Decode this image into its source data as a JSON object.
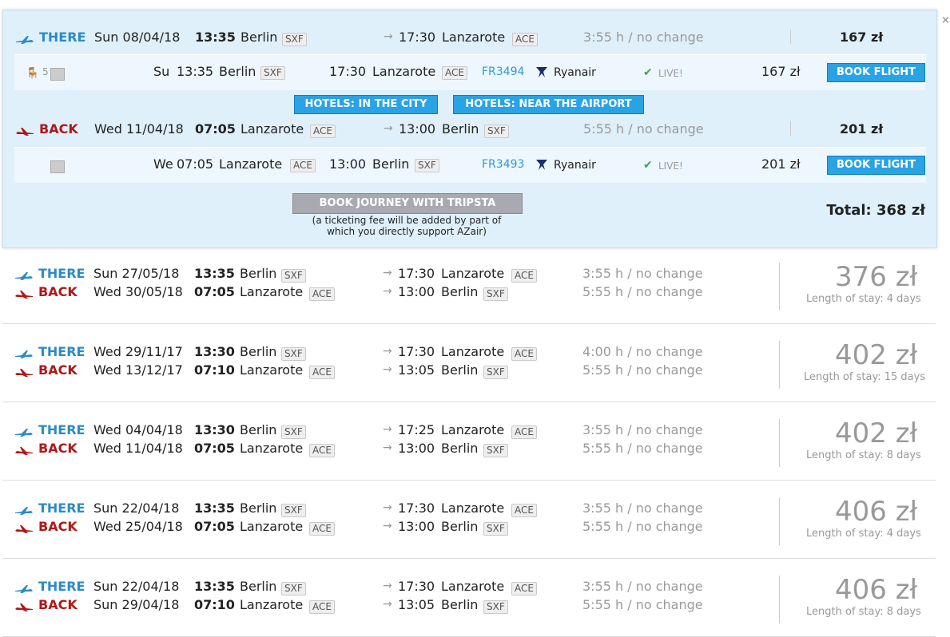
{
  "close_label": "×",
  "expanded": {
    "there": {
      "label": "THERE",
      "date": "Sun 08/04/18",
      "dep_time": "13:35",
      "dep_city": "Berlin",
      "dep_code": "SXF",
      "arr_time": "17:30",
      "arr_city": "Lanzarote",
      "arr_code": "ACE",
      "duration": "3:55 h / no change",
      "price": "167 zł"
    },
    "there_detail": {
      "seats": "5",
      "day": "Su",
      "dep_time": "13:35",
      "dep_city": "Berlin",
      "dep_code": "SXF",
      "arr_time": "17:30",
      "arr_city": "Lanzarote",
      "arr_code": "ACE",
      "flight_no": "FR3494",
      "airline": "Ryanair",
      "live": "LIVE!",
      "price": "167 zł",
      "book_label": "BOOK FLIGHT"
    },
    "hotels_city": "HOTELS: IN THE CITY",
    "hotels_airport": "HOTELS: NEAR THE AIRPORT",
    "back": {
      "label": "BACK",
      "date": "Wed 11/04/18",
      "dep_time": "07:05",
      "dep_city": "Lanzarote",
      "dep_code": "ACE",
      "arr_time": "13:00",
      "arr_city": "Berlin",
      "arr_code": "SXF",
      "duration": "5:55 h / no change",
      "price": "201 zł"
    },
    "back_detail": {
      "day": "We",
      "dep_time": "07:05",
      "dep_city": "Lanzarote",
      "dep_code": "ACE",
      "arr_time": "13:00",
      "arr_city": "Berlin",
      "arr_code": "SXF",
      "flight_no": "FR3493",
      "airline": "Ryanair",
      "live": "LIVE!",
      "price": "201 zł",
      "book_label": "BOOK FLIGHT"
    },
    "tripsta_label": "BOOK JOURNEY WITH TRIPSTA",
    "fee_line1": "(a ticketing fee will be added by part of",
    "fee_line2": "which you directly support AZair)",
    "total_label": "Total:",
    "total_value": "368 zł"
  },
  "results": [
    {
      "there": {
        "label": "THERE",
        "date": "Sun 27/05/18",
        "dep_time": "13:35",
        "dep_city": "Berlin",
        "dep_code": "SXF",
        "arr_time": "17:30",
        "arr_city": "Lanzarote",
        "arr_code": "ACE",
        "duration": "3:55 h / no change"
      },
      "back": {
        "label": "BACK",
        "date": "Wed 30/05/18",
        "dep_time": "07:05",
        "dep_city": "Lanzarote",
        "dep_code": "ACE",
        "arr_time": "13:00",
        "arr_city": "Berlin",
        "arr_code": "SXF",
        "duration": "5:55 h / no change"
      },
      "price": "376 zł",
      "stay": "Length of stay: 4 days"
    },
    {
      "there": {
        "label": "THERE",
        "date": "Wed 29/11/17",
        "dep_time": "13:30",
        "dep_city": "Berlin",
        "dep_code": "SXF",
        "arr_time": "17:30",
        "arr_city": "Lanzarote",
        "arr_code": "ACE",
        "duration": "4:00 h / no change"
      },
      "back": {
        "label": "BACK",
        "date": "Wed 13/12/17",
        "dep_time": "07:10",
        "dep_city": "Lanzarote",
        "dep_code": "ACE",
        "arr_time": "13:05",
        "arr_city": "Berlin",
        "arr_code": "SXF",
        "duration": "5:55 h / no change"
      },
      "price": "402 zł",
      "stay": "Length of stay: 15 days"
    },
    {
      "there": {
        "label": "THERE",
        "date": "Wed 04/04/18",
        "dep_time": "13:30",
        "dep_city": "Berlin",
        "dep_code": "SXF",
        "arr_time": "17:25",
        "arr_city": "Lanzarote",
        "arr_code": "ACE",
        "duration": "3:55 h / no change"
      },
      "back": {
        "label": "BACK",
        "date": "Wed 11/04/18",
        "dep_time": "07:05",
        "dep_city": "Lanzarote",
        "dep_code": "ACE",
        "arr_time": "13:00",
        "arr_city": "Berlin",
        "arr_code": "SXF",
        "duration": "5:55 h / no change"
      },
      "price": "402 zł",
      "stay": "Length of stay: 8 days"
    },
    {
      "there": {
        "label": "THERE",
        "date": "Sun 22/04/18",
        "dep_time": "13:35",
        "dep_city": "Berlin",
        "dep_code": "SXF",
        "arr_time": "17:30",
        "arr_city": "Lanzarote",
        "arr_code": "ACE",
        "duration": "3:55 h / no change"
      },
      "back": {
        "label": "BACK",
        "date": "Wed 25/04/18",
        "dep_time": "07:05",
        "dep_city": "Lanzarote",
        "dep_code": "ACE",
        "arr_time": "13:00",
        "arr_city": "Berlin",
        "arr_code": "SXF",
        "duration": "5:55 h / no change"
      },
      "price": "406 zł",
      "stay": "Length of stay: 4 days"
    },
    {
      "there": {
        "label": "THERE",
        "date": "Sun 22/04/18",
        "dep_time": "13:35",
        "dep_city": "Berlin",
        "dep_code": "SXF",
        "arr_time": "17:30",
        "arr_city": "Lanzarote",
        "arr_code": "ACE",
        "duration": "3:55 h / no change"
      },
      "back": {
        "label": "BACK",
        "date": "Sun 29/04/18",
        "dep_time": "07:10",
        "dep_city": "Lanzarote",
        "dep_code": "ACE",
        "arr_time": "13:05",
        "arr_city": "Berlin",
        "arr_code": "SXF",
        "duration": "5:55 h / no change"
      },
      "price": "406 zł",
      "stay": "Length of stay: 8 days"
    }
  ]
}
